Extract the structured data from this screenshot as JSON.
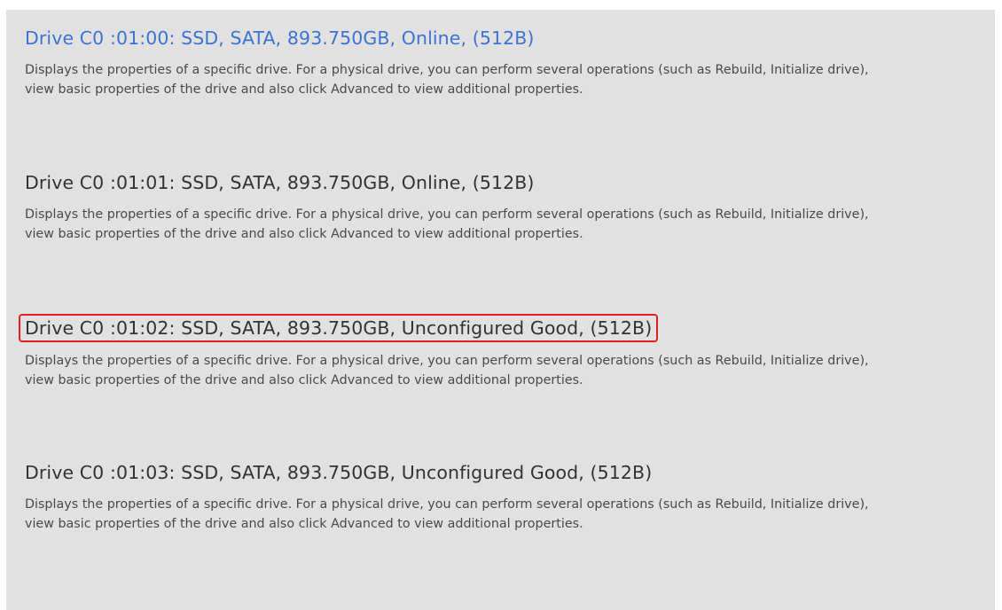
{
  "drives": [
    {
      "title": "Drive C0  :01:00: SSD, SATA, 893.750GB, Online, (512B)",
      "description": "Displays the properties of a specific drive. For a physical drive, you can perform several operations (such as Rebuild, Initialize drive), view basic properties of the drive and also click Advanced to view additional properties.",
      "state": "selected"
    },
    {
      "title": "Drive C0  :01:01: SSD, SATA, 893.750GB, Online, (512B)",
      "description": "Displays the properties of a specific drive. For a physical drive, you can perform several operations (such as Rebuild, Initialize drive), view basic properties of the drive and also click Advanced to view additional properties.",
      "state": "normal"
    },
    {
      "title": "Drive C0  :01:02: SSD, SATA, 893.750GB, Unconfigured Good, (512B)",
      "description": "Displays the properties of a specific drive. For a physical drive, you can perform several operations (such as Rebuild, Initialize drive), view basic properties of the drive and also click Advanced to view additional properties.",
      "state": "highlighted"
    },
    {
      "title": "Drive C0  :01:03: SSD, SATA, 893.750GB, Unconfigured Good, (512B)",
      "description": "Displays the properties of a specific drive. For a physical drive, you can perform several operations (such as Rebuild, Initialize drive), view basic properties of the drive and also click Advanced to view additional properties.",
      "state": "normal"
    }
  ],
  "colors": {
    "panel_background": "#e1e1e1",
    "selected_link": "#3b73d6",
    "highlight_box": "#e02020",
    "title_text": "#333333",
    "description_text": "#4a4a4a"
  }
}
